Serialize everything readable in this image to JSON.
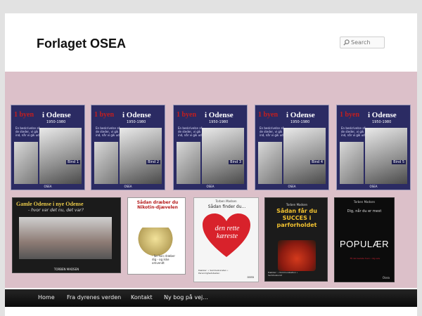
{
  "site": {
    "title": "Forlaget OSEA"
  },
  "search": {
    "placeholder": "Search"
  },
  "books_series": [
    {
      "t1": "1 byen",
      "t2": "i Odense",
      "years": "1950-1980",
      "sub": "En beskrivelse af de steder, vi gik ind, når vi gik ud.",
      "bind": "Bind 1",
      "publisher": "OSEA"
    },
    {
      "t1": "1 byen",
      "t2": "i Odense",
      "years": "1950-1980",
      "sub": "En beskrivelse af de steder, vi gik ind, når vi gik ud.",
      "bind": "Bind 2",
      "publisher": "OSEA"
    },
    {
      "t1": "1 byen",
      "t2": "i Odense",
      "years": "1950-1980",
      "sub": "En beskrivelse af de steder, vi gik ind, når vi gik ud.",
      "bind": "Bind 3",
      "publisher": "OSEA"
    },
    {
      "t1": "1 byen",
      "t2": "i Odense",
      "years": "1950-1980",
      "sub": "En beskrivelse af de steder, vi gik ind, når vi gik ud.",
      "bind": "Bind 4",
      "publisher": "OSEA"
    },
    {
      "t1": "1 byen",
      "t2": "i Odense",
      "years": "1950-1980",
      "sub": "En beskrivelse af de steder, vi gik ind, når vi gik ud.",
      "bind": "Bind 5",
      "publisher": "OSEA"
    }
  ],
  "book_gamle": {
    "title": "Gamle Odense i nye Odense",
    "subtitle": "- hvor var det nu, det var?",
    "author": "TORBEN MADSEN"
  },
  "book_nikotin": {
    "title": "Sådan dræber du Nikotin-djævelen",
    "small": "- før han dræber dig - og ikke omvendt"
  },
  "book_kaereste": {
    "author": "Torben Madsen",
    "title": "Sådan finder du...",
    "heart": "den rette kæreste",
    "small": "Dækker: • Samlivskunsten • Personlighedstesten",
    "logo": "osea"
  },
  "book_succes": {
    "author": "Torben Madsen",
    "title": "Sådan får du SUCCES i parforholdet",
    "small": "Dækker: • Kommunikation • Samlivskunst"
  },
  "book_populaer": {
    "author": "Torben Madsen",
    "subtitle": "Dig, når du er mest",
    "title": "POPULÆR",
    "small": "Få det bedste frem i dig selv",
    "logo": "Osea"
  },
  "nav": {
    "items": [
      "Home",
      "Fra dyrenes verden",
      "Kontakt",
      "Ny bog på vej..."
    ]
  },
  "colors": {
    "banner": "#dcc0c9",
    "navbar": "#111111",
    "page_bg": "#e2e2e2"
  }
}
